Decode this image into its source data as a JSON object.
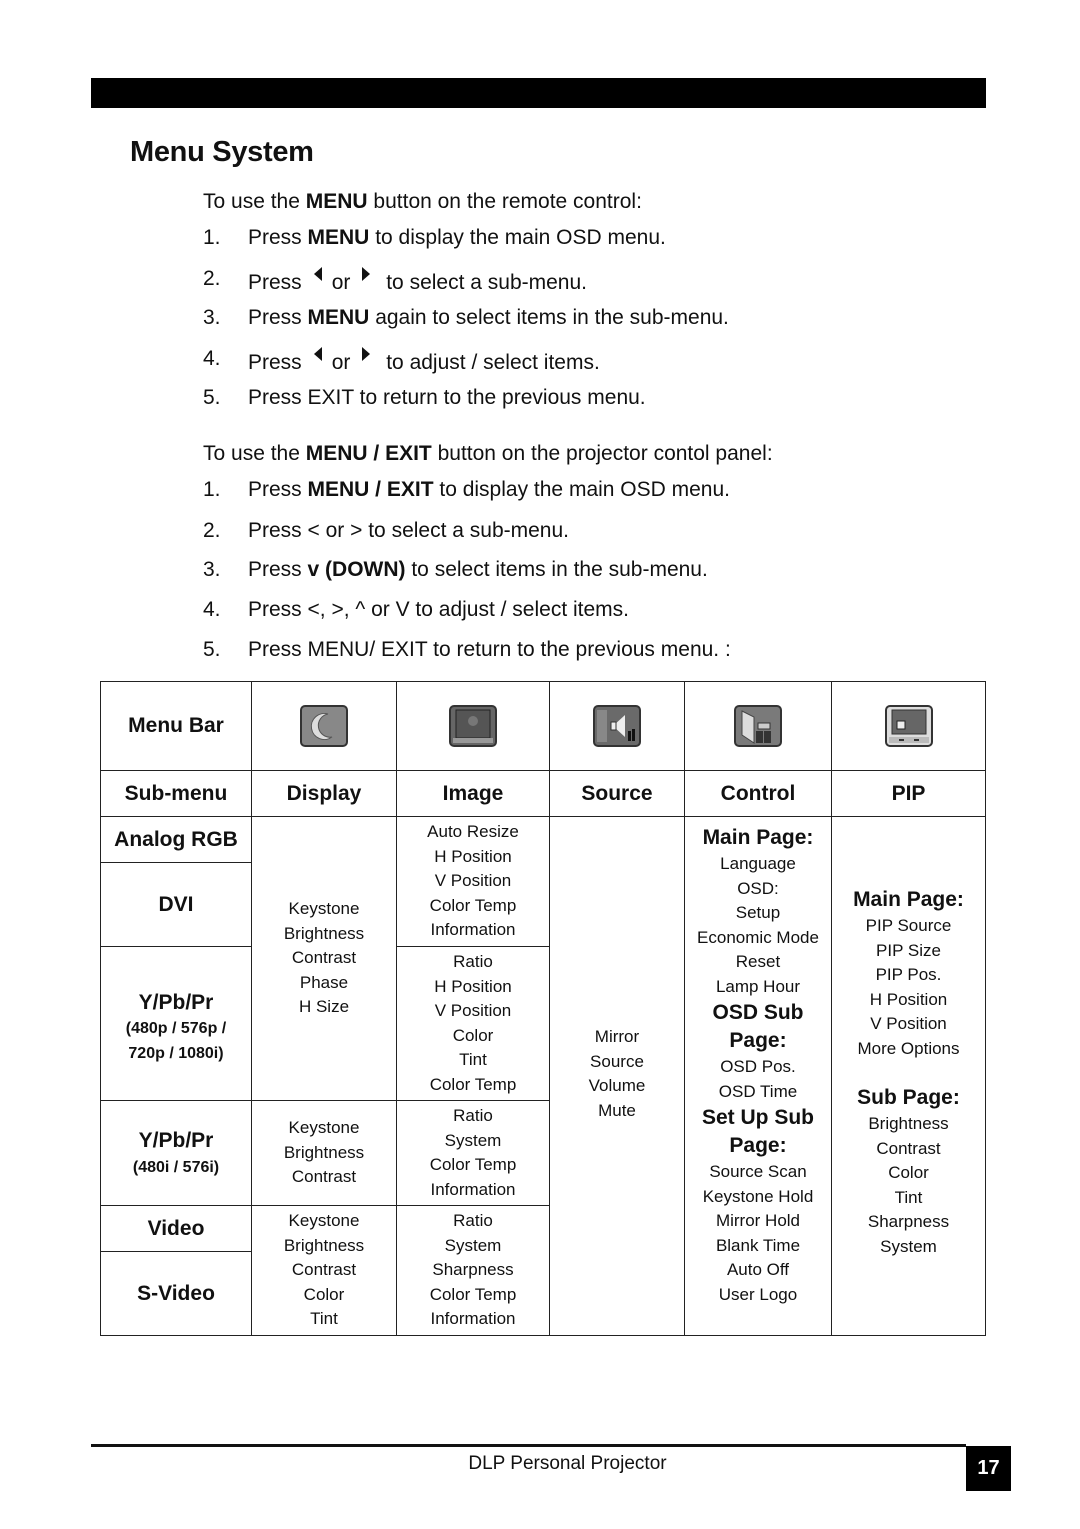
{
  "page": {
    "title": "Menu System",
    "footer": "DLP Personal Projector",
    "page_number": "17"
  },
  "remote": {
    "intro_pre": "To use the ",
    "intro_bold": "MENU",
    "intro_post": " button on the remote control:",
    "steps": [
      {
        "num": "1.",
        "pre": "Press ",
        "bold": "MENU",
        "post": " to display the main OSD menu."
      },
      {
        "num": "2.",
        "pre": "Press",
        "mid": "or",
        "post": "to select a sub-menu.",
        "icon_left": "left-triangle-icon",
        "icon_right": "right-triangle-icon"
      },
      {
        "num": "3.",
        "pre": "Press ",
        "bold": "MENU",
        "post": " again to select items in the sub-menu."
      },
      {
        "num": "4.",
        "pre": "Press",
        "mid": "or",
        "post": "to adjust / select items.",
        "icon_left": "left-triangle-icon",
        "icon_right": "right-triangle-icon"
      },
      {
        "num": "5.",
        "text": "Press EXIT to return to the previous menu."
      }
    ]
  },
  "panel": {
    "intro_pre": "To use the ",
    "intro_bold": "MENU / EXIT",
    "intro_post": " button on the projector contol panel:",
    "steps": [
      {
        "num": "1.",
        "pre": "Press ",
        "bold": "MENU / EXIT",
        "post": " to display the main OSD menu."
      },
      {
        "num": "2.",
        "text": "Press < or > to select a sub-menu."
      },
      {
        "num": "3.",
        "pre": "Press ",
        "bold": "v (DOWN)",
        "post": " to select items in the sub-menu."
      },
      {
        "num": "4.",
        "text": "Press <, >, ^ or V to adjust / select items."
      },
      {
        "num": "5.",
        "text": "Press MENU/ EXIT to return to the previous menu. :"
      }
    ]
  },
  "table": {
    "menu_bar_label": "Menu Bar",
    "submenu_label": "Sub-menu",
    "menu_icons": [
      "display-icon",
      "image-icon",
      "source-icon",
      "control-icon",
      "pip-icon"
    ],
    "submenus": [
      "Display",
      "Image",
      "Source",
      "Control",
      "PIP"
    ],
    "sources": {
      "analog_rgb": "Analog RGB",
      "dvi": "DVI",
      "ypbpr_p": "Y/Pb/Pr",
      "ypbpr_p_note": [
        "(480p / 576p /",
        "720p / 1080i)"
      ],
      "ypbpr_i": "Y/Pb/Pr",
      "ypbpr_i_note": "(480i / 576i)",
      "video": "Video",
      "svideo": "S-Video"
    },
    "display": {
      "rgb_dvi_ypbpr_p": [
        "Keystone",
        "Brightness",
        "Contrast",
        "Phase",
        "H Size"
      ],
      "ypbpr_i": [
        "Keystone",
        "Brightness",
        "Contrast"
      ],
      "video": [
        "Keystone",
        "Brightness",
        "Contrast",
        "Color",
        "Tint"
      ]
    },
    "image": {
      "rgb_dvi": [
        "Auto Resize",
        "H Position",
        "V Position",
        "Color Temp",
        "Information"
      ],
      "ypbpr_p": [
        "Ratio",
        "H Position",
        "V Position",
        "Color",
        "Tint",
        "Color Temp"
      ],
      "ypbpr_i": [
        "Ratio",
        "System",
        "Color Temp",
        "Information"
      ],
      "video": [
        "Ratio",
        "System",
        "Sharpness",
        "Color Temp",
        "Information"
      ]
    },
    "source": [
      "Mirror",
      "Source",
      "Volume",
      "Mute"
    ],
    "control": {
      "main_heading": "Main Page:",
      "main_items": [
        "Language",
        "OSD:",
        "Setup",
        "Economic Mode",
        "Reset",
        "Lamp Hour"
      ],
      "osd_heading": [
        "OSD Sub",
        "Page:"
      ],
      "osd_items": [
        "OSD Pos.",
        "OSD Time"
      ],
      "setup_heading": [
        "Set Up Sub",
        "Page:"
      ],
      "setup_items": [
        "Source Scan",
        "Keystone Hold",
        "Mirror Hold",
        "Blank Time",
        "Auto Off",
        "User Logo"
      ]
    },
    "pip": {
      "main_heading": "Main Page:",
      "main_items": [
        "PIP Source",
        "PIP Size",
        "PIP Pos.",
        "H Position",
        "V Position",
        "More Options"
      ],
      "sub_heading": "Sub Page:",
      "sub_items": [
        "Brightness",
        "Contrast",
        "Color",
        "Tint",
        "Sharpness",
        "System"
      ]
    }
  }
}
